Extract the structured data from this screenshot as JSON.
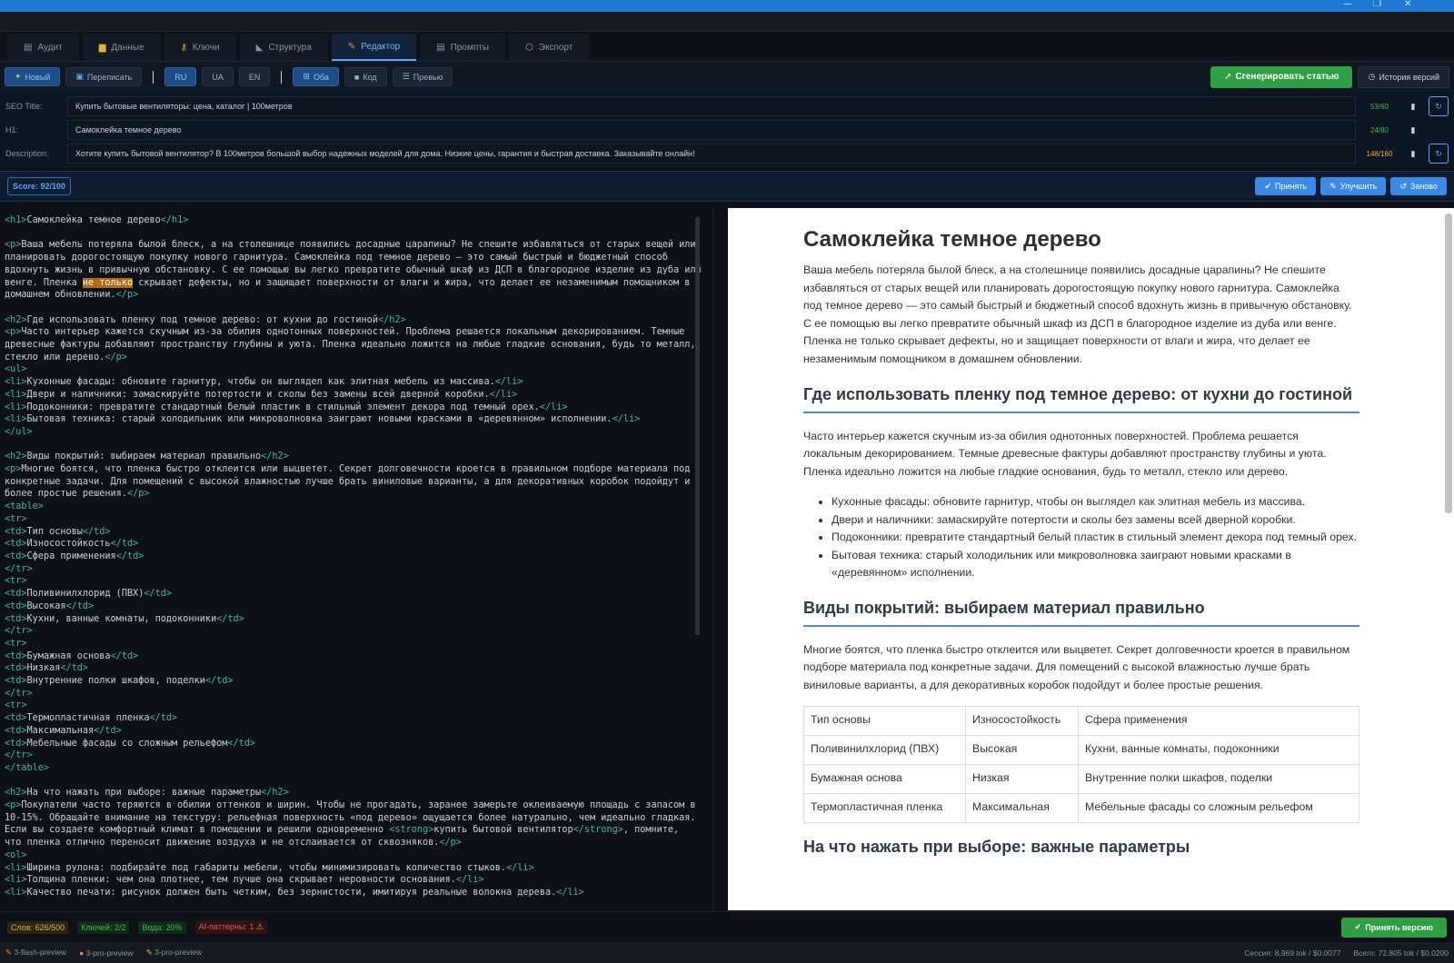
{
  "window": {
    "minimize": "—",
    "restore": "❐",
    "close": "✕"
  },
  "tabs": [
    {
      "label": "Аудит",
      "icon": "chart-icon",
      "color": "#8b949e"
    },
    {
      "label": "Данные",
      "icon": "folder-icon",
      "color": "#e3b341"
    },
    {
      "label": "Ключи",
      "icon": "key-icon",
      "color": "#e3b341"
    },
    {
      "label": "Структура",
      "icon": "ruler-icon",
      "color": "#8b949e"
    },
    {
      "label": "Редактор",
      "icon": "pencil-icon",
      "color": "#f0883e"
    },
    {
      "label": "Промпты",
      "icon": "document-icon",
      "color": "#8b949e"
    },
    {
      "label": "Экспорт",
      "icon": "export-icon",
      "color": "#bc8cff"
    }
  ],
  "toolbar": {
    "new_label": "Новый",
    "rewrite_label": "Переписать",
    "lang_ru": "RU",
    "lang_ua": "UA",
    "lang_en": "EN",
    "view_both": "Оба",
    "view_code": "Код",
    "view_preview": "Превью",
    "generate_label": "Сгенерировать статью",
    "history_label": "История версий"
  },
  "seo": {
    "title_label": "SEO Title:",
    "title_value": "Купить бытовые вентиляторы: цена, каталог | 100метров",
    "title_count": "53/60",
    "h1_label": "H1:",
    "h1_value": "Самоклейка темное дерево",
    "h1_count": "24/80",
    "desc_label": "Description:",
    "desc_value": "Хотите купить бытовой вентилятор? В 100метров большой выбор надежных моделей для дома. Низкие цены, гарантия и быстрая доставка. Заказывайте онлайн!",
    "desc_count": "148/160",
    "count_color_ok": "#3fb950",
    "count_color_warn": "#e3b341"
  },
  "score": {
    "label": "Score: 92/100",
    "accept": "Принять",
    "improve": "Улучшить",
    "redo": "Заново"
  },
  "code_lines": [
    "<h1>Самоклейка темное дерево</h1>",
    "",
    "<p>Ваша мебель потеряла былой блеск, а на столешнице появились досадные царапины? Не спешите избавляться от старых вещей или",
    "планировать дорогостоящую покупку нового гарнитура. Самоклейка под темное дерево — это самый быстрый и бюджетный способ",
    "вдохнуть жизнь в привычную обстановку. С ее помощью вы легко превратите обычный шкаф из ДСП в благородное изделие из дуба или",
    "венге. Пленка не только скрывает дефекты, но и защищает поверхности от влаги и жира, что делает ее незаменимым помощником в",
    "домашнем обновлении.</p>",
    "",
    "<h2>Где использовать пленку под темное дерево: от кухни до гостиной</h2>",
    "<p>Часто интерьер кажется скучным из-за обилия однотонных поверхностей. Проблема решается локальным декорированием. Темные",
    "древесные фактуры добавляют пространству глубины и уюта. Пленка идеально ложится на любые гладкие основания, будь то металл,",
    "стекло или дерево.</p>",
    "<ul>",
    "<li>Кухонные фасады: обновите гарнитур, чтобы он выглядел как элитная мебель из массива.</li>",
    "<li>Двери и наличники: замаскируйте потертости и сколы без замены всей дверной коробки.</li>",
    "<li>Подоконники: превратите стандартный белый пластик в стильный элемент декора под темный орех.</li>",
    "<li>Бытовая техника: старый холодильник или микроволновка заиграют новыми красками в «деревянном» исполнении.</li>",
    "</ul>",
    "",
    "<h2>Виды покрытий: выбираем материал правильно</h2>",
    "<p>Многие боятся, что пленка быстро отклеится или выцветет. Секрет долговечности кроется в правильном подборе материала под",
    "конкретные задачи. Для помещений с высокой влажностью лучше брать виниловые варианты, а для декоративных коробок подойдут и",
    "более простые решения.</p>",
    "<table>",
    "<tr>",
    "<td>Тип основы</td>",
    "<td>Износостойкость</td>",
    "<td>Сфера применения</td>",
    "</tr>",
    "<tr>",
    "<td>Поливинилхлорид (ПВХ)</td>",
    "<td>Высокая</td>",
    "<td>Кухни, ванные комнаты, подоконники</td>",
    "</tr>",
    "<tr>",
    "<td>Бумажная основа</td>",
    "<td>Низкая</td>",
    "<td>Внутренние полки шкафов, поделки</td>",
    "</tr>",
    "<tr>",
    "<td>Термопластичная пленка</td>",
    "<td>Максимальная</td>",
    "<td>Мебельные фасады со сложным рельефом</td>",
    "</tr>",
    "</table>",
    "",
    "<h2>На что нажать при выборе: важные параметры</h2>",
    "<p>Покупатели часто теряются в обилии оттенков и ширин. Чтобы не прогадать, заранее замерьте оклеиваемую площадь с запасом в",
    "10-15%. Обращайте внимание на текстуру: рельефная поверхность «под дерево» ощущается более натурально, чем идеально гладкая.",
    "Если вы создаете комфортный климат в помещении и решили одновременно <strong>купить бытовой вентилятор</strong>, помните,",
    "что пленка отлично переносит движение воздуха и не отслаивается от сквозняков.</p>",
    "<ol>",
    "<li>Ширина рулона: подбирайте под габариты мебели, чтобы минимизировать количество стыков.</li>",
    "<li>Толщина пленки: чем она плотнее, тем лучше она скрывает неровности основания.</li>",
    "<li>Качество печати: рисунок должен быть четким, без зернистости, имитируя реальные волокна дерева.</li>"
  ],
  "highlight_phrase": "не только",
  "preview": {
    "h1": "Самоклейка темное дерево",
    "p1": "Ваша мебель потеряла былой блеск, а на столешнице появились досадные царапины? Не спешите избавляться от старых вещей или планировать дорогостоящую покупку нового гарнитура. Самоклейка под темное дерево — это самый быстрый и бюджетный способ вдохнуть жизнь в привычную обстановку. С ее помощью вы легко превратите обычный шкаф из ДСП в благородное изделие из дуба или венге. Пленка не только скрывает дефекты, но и защищает поверхности от влаги и жира, что делает ее незаменимым помощником в домашнем обновлении.",
    "h2a": "Где использовать пленку под темное дерево: от кухни до гостиной",
    "p2": "Часто интерьер кажется скучным из-за обилия однотонных поверхностей. Проблема решается локальным декорированием. Темные древесные фактуры добавляют пространству глубины и уюта. Пленка идеально ложится на любые гладкие основания, будь то металл, стекло или дерево.",
    "list": [
      "Кухонные фасады: обновите гарнитур, чтобы он выглядел как элитная мебель из массива.",
      "Двери и наличники: замаскируйте потертости и сколы без замены всей дверной коробки.",
      "Подоконники: превратите стандартный белый пластик в стильный элемент декора под темный орех.",
      "Бытовая техника: старый холодильник или микроволновка заиграют новыми красками в «деревянном» исполнении."
    ],
    "h2b": "Виды покрытий: выбираем материал правильно",
    "p3": "Многие боятся, что пленка быстро отклеится или выцветет. Секрет долговечности кроется в правильном подборе материала под конкретные задачи. Для помещений с высокой влажностью лучше брать виниловые варианты, а для декоративных коробок подойдут и более простые решения.",
    "table": [
      [
        "Тип основы",
        "Износостойкость",
        "Сфера применения"
      ],
      [
        "Поливинилхлорид (ПВХ)",
        "Высокая",
        "Кухни, ванные комнаты, подоконники"
      ],
      [
        "Бумажная основа",
        "Низкая",
        "Внутренние полки шкафов, поделки"
      ],
      [
        "Термопластичная пленка",
        "Максимальная",
        "Мебельные фасады со сложным рельефом"
      ]
    ],
    "h2c": "На что нажать при выборе: важные параметры"
  },
  "status": {
    "words": "Слов: 626/500",
    "keys": "Ключей: 2/2",
    "water": "Вода: 20%",
    "ai": "AI-паттерны: 1",
    "accept_version": "Принять версию"
  },
  "footer": {
    "models": [
      "3-flash-preview",
      "3-pro-preview",
      "3-pro-preview"
    ],
    "session": "Сессия: 8,969 tok / $0.0077",
    "total": "Всего: 72,805 tok / $0.0200"
  }
}
